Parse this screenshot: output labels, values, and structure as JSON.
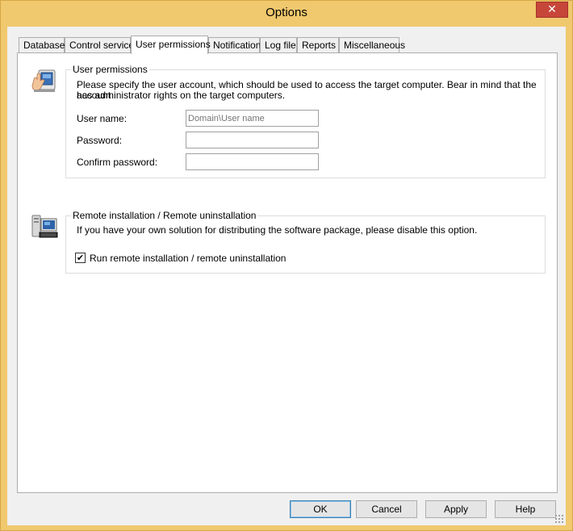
{
  "window": {
    "title": "Options",
    "close_glyph": "✕"
  },
  "tabs": [
    {
      "label": "Database"
    },
    {
      "label": "Control service"
    },
    {
      "label": "User permissions",
      "active": true
    },
    {
      "label": "Notification"
    },
    {
      "label": "Log file"
    },
    {
      "label": "Reports"
    },
    {
      "label": "Miscellaneous"
    }
  ],
  "user_permissions": {
    "legend": "User permissions",
    "description_line1": "Please specify the user account, which should be used to access the target computer. Bear in mind that the account",
    "description_line2": "has administrator rights on the target computers.",
    "icon": "user-hand-icon",
    "username_label": "User name:",
    "username_value": "",
    "username_placeholder": "Domain\\User name",
    "password_label": "Password:",
    "password_value": "",
    "confirm_label": "Confirm password:",
    "confirm_value": ""
  },
  "remote_install": {
    "legend": "Remote installation / Remote uninstallation",
    "description": "If you have your own solution for distributing the software package, please disable this option.",
    "icon": "computer-icon",
    "checkbox_label": "Run remote installation / remote uninstallation",
    "checkbox_checked": true,
    "check_glyph": "✔"
  },
  "buttons": {
    "ok": "OK",
    "cancel": "Cancel",
    "apply": "Apply",
    "help": "Help"
  },
  "colors": {
    "title_bar": "#f0c86e",
    "close_button": "#c7463a",
    "client_bg": "#f0f0f0",
    "panel_bg": "#ffffff"
  }
}
